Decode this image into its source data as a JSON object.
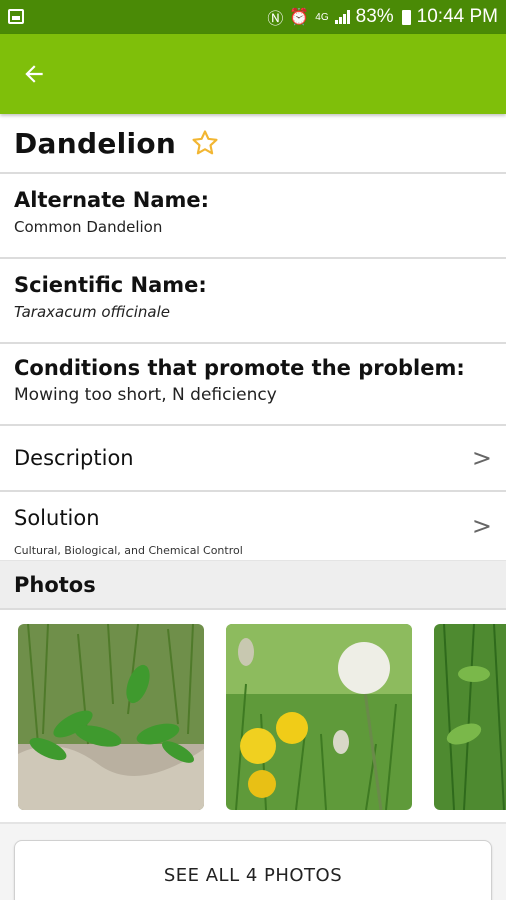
{
  "status_bar": {
    "battery": "83%",
    "time": "10:44 PM",
    "network": "4G"
  },
  "app_bar": {
    "back_icon": "arrow-left-icon",
    "color": "#7fbf0a"
  },
  "plant": {
    "name": "Dandelion",
    "alternate_name_label": "Alternate Name:",
    "alternate_name": "Common Dandelion",
    "scientific_name_label": "Scientific Name:",
    "scientific_name": "Taraxacum officinale",
    "conditions_label": "Conditions that promote the problem:",
    "conditions": "Mowing too short, N deficiency"
  },
  "sections": {
    "description_label": "Description",
    "solution_label": "Solution",
    "solution_sub": "Cultural, Biological, and Chemical Control"
  },
  "photos": {
    "header": "Photos",
    "see_all_label": "SEE ALL 4 PHOTOS"
  },
  "colors": {
    "status_bar": "#4a8a06",
    "star": "#f2b632"
  }
}
